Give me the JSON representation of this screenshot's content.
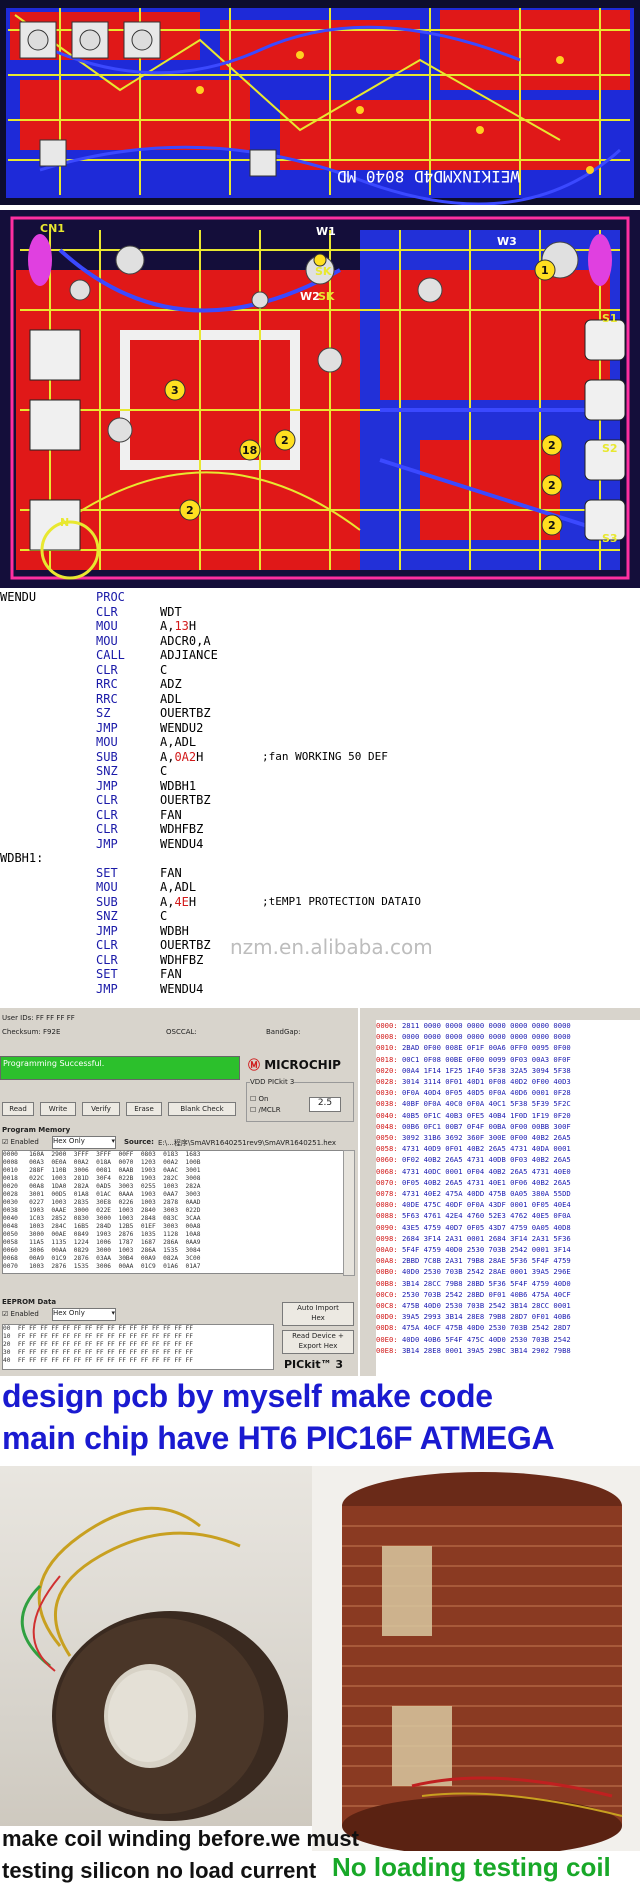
{
  "pcb_top": {
    "label": "WEIKINXMD4D 8040 MD"
  },
  "pcb_main": {
    "labels": [
      "CN1",
      "W1",
      "W2",
      "W3",
      "SK",
      "SK",
      "S1",
      "S2",
      "S3",
      "3",
      "18",
      "2",
      "2",
      "2",
      "2",
      "1",
      "2",
      "N"
    ]
  },
  "code": {
    "lines": [
      {
        "label": "WENDU",
        "op": "PROC",
        "arg": "",
        "num": "",
        "suffix": "",
        "comment": ""
      },
      {
        "label": "",
        "op": "CLR",
        "arg": "WDT",
        "num": "",
        "suffix": "",
        "comment": ""
      },
      {
        "label": "",
        "op": "MOU",
        "arg": "A,",
        "num": "13",
        "suffix": "H",
        "comment": ""
      },
      {
        "label": "",
        "op": "MOU",
        "arg": "ADCR0,A",
        "num": "",
        "suffix": "",
        "comment": ""
      },
      {
        "label": "",
        "op": "CALL",
        "arg": "ADJIANCE",
        "num": "",
        "suffix": "",
        "comment": ""
      },
      {
        "label": "",
        "op": "CLR",
        "arg": "C",
        "num": "",
        "suffix": "",
        "comment": ""
      },
      {
        "label": "",
        "op": "RRC",
        "arg": "ADZ",
        "num": "",
        "suffix": "",
        "comment": ""
      },
      {
        "label": "",
        "op": "RRC",
        "arg": "ADL",
        "num": "",
        "suffix": "",
        "comment": ""
      },
      {
        "label": "",
        "op": "SZ",
        "arg": "OUERTBZ",
        "num": "",
        "suffix": "",
        "comment": ""
      },
      {
        "label": "",
        "op": "JMP",
        "arg": "WENDU2",
        "num": "",
        "suffix": "",
        "comment": ""
      },
      {
        "label": "",
        "op": "MOU",
        "arg": "A,ADL",
        "num": "",
        "suffix": "",
        "comment": ""
      },
      {
        "label": "",
        "op": "SUB",
        "arg": "A,",
        "num": "0A2",
        "suffix": "H",
        "comment": ";fan WORKING 50 DEF"
      },
      {
        "label": "",
        "op": "SNZ",
        "arg": "C",
        "num": "",
        "suffix": "",
        "comment": ""
      },
      {
        "label": "",
        "op": "JMP",
        "arg": "WDBH1",
        "num": "",
        "suffix": "",
        "comment": ""
      },
      {
        "label": "",
        "op": "CLR",
        "arg": "OUERTBZ",
        "num": "",
        "suffix": "",
        "comment": ""
      },
      {
        "label": "",
        "op": "CLR",
        "arg": "FAN",
        "num": "",
        "suffix": "",
        "comment": ""
      },
      {
        "label": "",
        "op": "CLR",
        "arg": "WDHFBZ",
        "num": "",
        "suffix": "",
        "comment": ""
      },
      {
        "label": "",
        "op": "JMP",
        "arg": "WENDU4",
        "num": "",
        "suffix": "",
        "comment": ""
      },
      {
        "label": "WDBH1:",
        "op": "",
        "arg": "",
        "num": "",
        "suffix": "",
        "comment": ""
      },
      {
        "label": "",
        "op": "SET",
        "arg": "FAN",
        "num": "",
        "suffix": "",
        "comment": ""
      },
      {
        "label": "",
        "op": "MOU",
        "arg": "A,ADL",
        "num": "",
        "suffix": "",
        "comment": ""
      },
      {
        "label": "",
        "op": "SUB",
        "arg": "A,",
        "num": "4E",
        "suffix": "H",
        "comment": ";tEMP1 PROTECTION DATAIO"
      },
      {
        "label": "",
        "op": "SNZ",
        "arg": "C",
        "num": "",
        "suffix": "",
        "comment": ""
      },
      {
        "label": "",
        "op": "JMP",
        "arg": "WDBH",
        "num": "",
        "suffix": "",
        "comment": ""
      },
      {
        "label": "",
        "op": "CLR",
        "arg": "OUERTBZ",
        "num": "",
        "suffix": "",
        "comment": ""
      },
      {
        "label": "",
        "op": "CLR",
        "arg": "WDHFBZ",
        "num": "",
        "suffix": "",
        "comment": ""
      },
      {
        "label": "",
        "op": "SET",
        "arg": "FAN",
        "num": "",
        "suffix": "",
        "comment": ""
      },
      {
        "label": "",
        "op": "JMP",
        "arg": "WENDU4",
        "num": "",
        "suffix": "",
        "comment": ""
      }
    ],
    "watermark": "nzm.en.alibaba.com"
  },
  "pickit": {
    "user_ids": "User IDs:   FF FF FF FF",
    "checksum": "Checksum:   F92E",
    "osccal": "OSCCAL:",
    "bandgap": "BandGap:",
    "status": "Programming Successful.",
    "brand": "MICROCHIP",
    "buttons": [
      "Read",
      "Write",
      "Verify",
      "Erase",
      "Blank Check"
    ],
    "vdd_label": "VDD PICkit 3",
    "vdd_on": "On",
    "vdd_mclr": "/MCLR",
    "vdd_value": "2.5",
    "program_memory": "Program Memory",
    "enabled": "Enabled",
    "hex_only": "Hex Only",
    "source_label": "Source:",
    "source_path": "E:\\...程序\\SmAVR1640251rev9\\SmAVR1640251.hex",
    "pm_rows": [
      "0000   160A  2900  3FFF  3FFF  00FF  0803  0183  1683",
      "0008   00A3  0E0A  00A2  018A  0070  1203  00A2  100B",
      "0010   288F  110B  3006  0081  0AAB  1903  0AAC  3001",
      "0018   022C  1003  281D  30F4  022B  1903  282C  3008",
      "0020   00A8  1DA0  282A  0AD5  3003  0255  1003  282A",
      "0028   3001  00D5  01A8  01AC  0AAA  1903  0AA7  3003",
      "0030   0227  1003  2835  30E8  0226  1003  2878  0AAD",
      "0038   1903  0AAE  3000  022E  1003  2840  3003  022D",
      "0040   1C03  2852  0830  3000  1003  2848  083C  3CAA",
      "0048   1003  284C  16B5  284D  12B5  01EF  3003  00A8",
      "0050   3000  00AE  0849  1903  2876  1035  1128  10A8",
      "0058   11A5  1135  1224  1006  1787  1687  286A  0AA9",
      "0060   3006  00AA  0829  3000  1003  286A  1535  3084",
      "0068   00A9  01C9  2876  03AA  30B4  00A9  082A  3C00",
      "0070   1003  2876  1535  3006  00AA  01C9  01A6  01A7"
    ],
    "eeprom_label": "EEPROM Data",
    "eeprom_rows": [
      "00  FF FF FF FF FF FF FF FF FF FF FF FF FF FF FF FF",
      "10  FF FF FF FF FF FF FF FF FF FF FF FF FF FF FF FF",
      "20  FF FF FF FF FF FF FF FF FF FF FF FF FF FF FF FF",
      "30  FF FF FF FF FF FF FF FF FF FF FF FF FF FF FF FF",
      "40  FF FF FF FF FF FF FF FF FF FF FF FF FF FF FF FF"
    ],
    "auto_import": "Auto Import\nHex",
    "read_device": "Read Device +\nExport Hex",
    "pickit_logo": "PICkit™ 3"
  },
  "hexdump": {
    "rows": [
      [
        "0000:",
        "2811 0000 0000 0000 0000 0000 0000 0000"
      ],
      [
        "0008:",
        "0000 0000 0000 0000 0000 0000 0000 0000"
      ],
      [
        "0010:",
        "2BAD 0F00 008E 0F1F 00A6 0FF0 0095 0F00"
      ],
      [
        "0018:",
        "00C1 0F08 00BE 0F00 0099 0F03 00A3 0F0F"
      ],
      [
        "0020:",
        "00A4 1F14 1F25 1F40 5F38 32A5 3094 5F38"
      ],
      [
        "0028:",
        "3014 3114 0F01 40D1 0F08 40D2 0F00 40D3"
      ],
      [
        "0030:",
        "0F0A 40D4 0F05 40D5 0F0A 40D6 0001 0F28"
      ],
      [
        "0038:",
        "40BF 0F0A 40C0 0F0A 40C1 5F38 5F39 5F2C"
      ],
      [
        "0040:",
        "40B5 0F1C 40B3 0FE5 40B4 1F0D 1F19 0F20"
      ],
      [
        "0048:",
        "00B6 0FC1 00B7 0F4F 00BA 0F00 00BB 300F"
      ],
      [
        "0050:",
        "3092 31B6 3692 360F 300E 0F00 40B2 26A5"
      ],
      [
        "0058:",
        "4731 40D9 0F01 40B2 26A5 4731 40DA 0001"
      ],
      [
        "0060:",
        "0F02 40B2 26A5 4731 40DB 0F03 40B2 26A5"
      ],
      [
        "0068:",
        "4731 40DC 0001 0F04 40B2 26A5 4731 40E0"
      ],
      [
        "0070:",
        "0F05 40B2 26A5 4731 40E1 0F06 40B2 26A5"
      ],
      [
        "0078:",
        "4731 40E2 475A 40DD 475B 0A05 380A 55DD"
      ],
      [
        "0080:",
        "40DE 475C 40DF 0F0A 43DF 0001 0F05 40E4"
      ],
      [
        "0088:",
        "5F63 4761 42E4 4760 52E3 4762 40E5 0F0A"
      ],
      [
        "0090:",
        "43E5 4759 40D7 0F05 43D7 4759 0A05 40D8"
      ],
      [
        "0098:",
        "2684 3F14 2A31 0001 2684 3F14 2A31 5F36"
      ],
      [
        "00A0:",
        "5F4F 4759 40D0 2530 703B 2542 0001 3F14"
      ],
      [
        "00A8:",
        "2BBD 7C8B 2A31 79B8 28AE 5F36 5F4F 4759"
      ],
      [
        "00B0:",
        "40D0 2530 703B 2542 28AE 0001 39A5 296E"
      ],
      [
        "00B8:",
        "3B14 28CC 79B8 28BD 5F36 5F4F 4759 40D0"
      ],
      [
        "00C0:",
        "2530 703B 2542 28BD 0F01 40B6 475A 40CF"
      ],
      [
        "00C8:",
        "475B 40D0 2530 703B 2542 3B14 28CC 0001"
      ],
      [
        "00D0:",
        "39A5 2993 3B14 28E8 79B8 28D7 0F01 40B6"
      ],
      [
        "00D8:",
        "475A 40CF 475B 40D0 2530 703B 2542 28D7"
      ],
      [
        "00E0:",
        "40D0 40B6 5F4F 475C 40D0 2530 703B 2542"
      ],
      [
        "00E8:",
        "3B14 28E8 0001 39A5 29BC 3B14 2902 79B8"
      ]
    ]
  },
  "captions": {
    "line1": "design pcb by myself make code",
    "line2": "main chip have HT6 PIC16F ATMEGA"
  },
  "photos": {
    "left_caption_1": "make coil winding before.we must",
    "left_caption_2": "testing silicon no load current",
    "right_caption": "No loading testing coil"
  }
}
